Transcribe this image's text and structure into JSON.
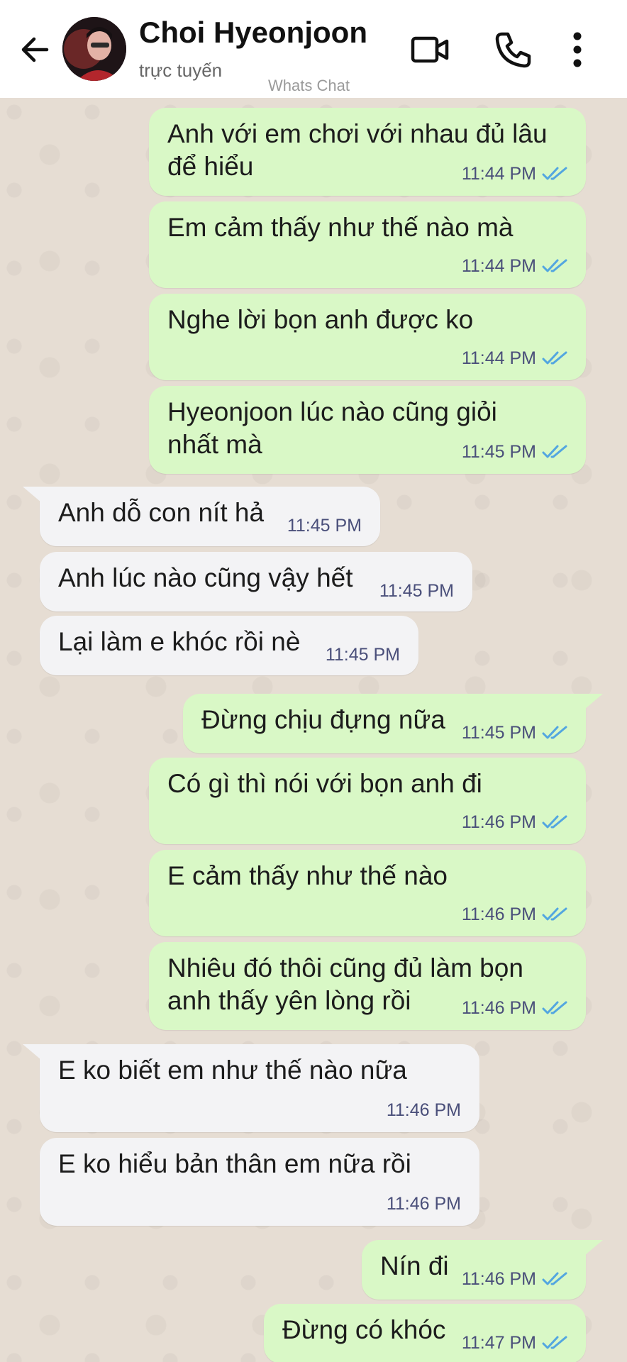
{
  "header": {
    "name": "Choi Hyeonjoon",
    "status": "trực tuyến",
    "watermark": "Whats Chat"
  },
  "messages": [
    {
      "dir": "out",
      "lines": [
        "Anh với em chơi với nhau đủ lâu",
        "để hiểu"
      ],
      "time": "11:44 PM",
      "read": true
    },
    {
      "dir": "out",
      "lines": [
        "Em cảm thấy như thế nào mà"
      ],
      "time": "11:44 PM",
      "read": true
    },
    {
      "dir": "out",
      "lines": [
        "Nghe lời bọn anh được ko"
      ],
      "time": "11:44 PM",
      "read": true
    },
    {
      "dir": "out",
      "lines": [
        "Hyeonjoon lúc nào cũng giỏi",
        "nhất mà"
      ],
      "time": "11:45 PM",
      "read": true
    },
    {
      "dir": "in",
      "lines": [
        "Anh dỗ con nít hả"
      ],
      "time": "11:45 PM"
    },
    {
      "dir": "in",
      "lines": [
        "Anh lúc nào cũng vậy hết"
      ],
      "time": "11:45 PM"
    },
    {
      "dir": "in",
      "lines": [
        "Lại làm e khóc rồi nè"
      ],
      "time": "11:45 PM"
    },
    {
      "dir": "out",
      "lines": [
        "Đừng chịu đựng nữa"
      ],
      "time": "11:45 PM",
      "read": true
    },
    {
      "dir": "out",
      "lines": [
        "Có gì thì nói với bọn anh đi"
      ],
      "time": "11:46 PM",
      "read": true
    },
    {
      "dir": "out",
      "lines": [
        "E cảm thấy như thế nào"
      ],
      "time": "11:46 PM",
      "read": true
    },
    {
      "dir": "out",
      "lines": [
        "Nhiêu đó thôi cũng đủ làm bọn",
        "anh thấy yên lòng rồi"
      ],
      "time": "11:46 PM",
      "read": true
    },
    {
      "dir": "in",
      "lines": [
        "E ko biết em như thế nào nữa"
      ],
      "time": "11:46 PM"
    },
    {
      "dir": "in",
      "lines": [
        "E ko hiểu bản thân em nữa rồi"
      ],
      "time": "11:46 PM"
    },
    {
      "dir": "out",
      "lines": [
        "Nín đi"
      ],
      "time": "11:46 PM",
      "read": true
    },
    {
      "dir": "out",
      "lines": [
        "Đừng có khóc"
      ],
      "time": "11:47 PM",
      "read": true
    }
  ],
  "colors": {
    "outgoing_bubble": "#d9f8c6",
    "incoming_bubble": "#f3f3f5",
    "read_ticks": "#53a6e0",
    "background": "#e6ddd3"
  },
  "icons": {
    "back": "arrow-left-icon",
    "video": "video-camera-icon",
    "call": "phone-icon",
    "more": "more-vertical-icon",
    "read": "double-check-icon"
  }
}
